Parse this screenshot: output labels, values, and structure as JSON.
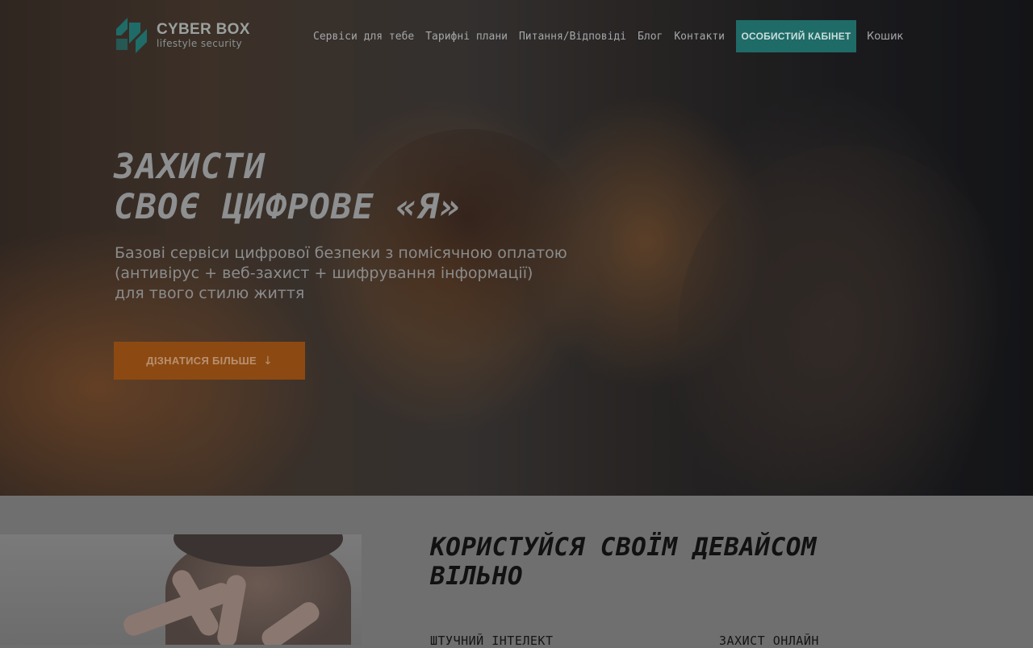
{
  "brand": {
    "name": "CYBER BOX",
    "tagline": "lifestyle security",
    "colors": {
      "teal": "#1f6b68",
      "orange": "#8c4a12"
    }
  },
  "nav": {
    "items": [
      {
        "label": "Сервіси для тебе"
      },
      {
        "label": "Тарифні плани"
      },
      {
        "label": "Питання/Відповіді"
      },
      {
        "label": "Блог"
      },
      {
        "label": "Контакти"
      }
    ],
    "cabinet_label": "ОСОБИСТИЙ КАБІНЕТ",
    "cart_label": "Кошик"
  },
  "hero": {
    "title_lines": [
      "ЗАХИСТИ",
      "СВОЄ ЦИФРОВЕ «Я»"
    ],
    "description_lines": [
      "Базові сервіси цифрової безпеки з помісячною оплатою",
      "(антивірус + веб-захист + шифрування інформації)",
      "для твого стилю життя"
    ],
    "cta_label": "ДІЗНАТИСЯ БІЛЬШЕ",
    "cta_icon": "arrow-down-icon",
    "cta_icon_glyph": "↓"
  },
  "section2": {
    "title_lines": [
      "КОРИСТУЙСЯ СВОЇМ ДЕВАЙСОМ",
      "ВІЛЬНО"
    ],
    "features": [
      {
        "label": "ШТУЧНИЙ ІНТЕЛЕКТ"
      },
      {
        "label": "ЗАХИСТ ОНЛАЙН"
      }
    ]
  }
}
